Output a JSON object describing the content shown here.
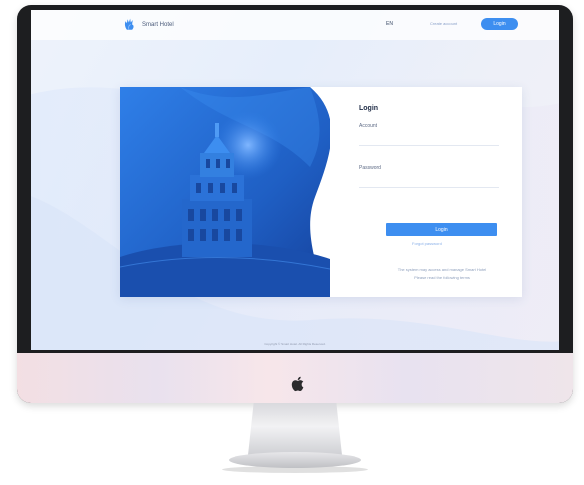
{
  "nav": {
    "brand_name": "Smart Hotel",
    "language": "EN",
    "create_account": "Create account",
    "login_button": "Login"
  },
  "login_card": {
    "title": "Login",
    "account_label": "Account",
    "account_value": "",
    "password_label": "Password",
    "password_value": "",
    "submit_label": "Login",
    "forgot_label": "Forgot password",
    "notice_line1": "The system may access and manage Smart Hotel",
    "notice_line2": "Please read the following terms"
  },
  "footer": {
    "copyright": "Copyright © Smart Hotel. All Rights Reserved."
  },
  "colors": {
    "accent": "#3d8ef0",
    "illustration_blue": "#1f5fc4",
    "monitor_bezel": "#1d1e20"
  },
  "icons": {
    "brand": "hand-logo-icon",
    "device": "apple-logo-icon"
  }
}
